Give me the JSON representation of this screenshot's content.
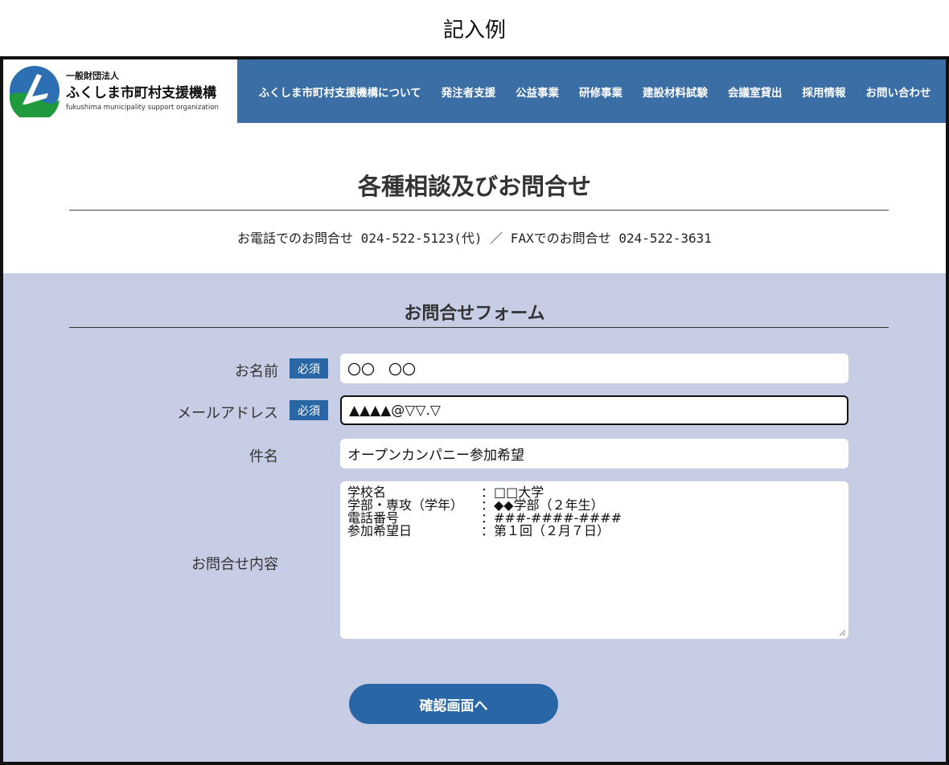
{
  "caption": "記入例",
  "logo": {
    "small_text": "一般財団法人",
    "main_text": "ふくしま市町村支援機構",
    "english_text": "fukushima municipality support organization"
  },
  "nav": {
    "items": [
      {
        "label": "ふくしま市町村支援機構について"
      },
      {
        "label": "発注者支援"
      },
      {
        "label": "公益事業"
      },
      {
        "label": "研修事業"
      },
      {
        "label": "建設材料試験"
      },
      {
        "label": "会議室貸出"
      },
      {
        "label": "採用情報"
      },
      {
        "label": "お問い合わせ"
      }
    ]
  },
  "contact": {
    "title": "各種相談及びお問合せ",
    "phone_line": "お電話でのお問合せ 024-522-5123(代) ／ FAXでのお問合せ 024-522-3631"
  },
  "form": {
    "title": "お問合せフォーム",
    "required_label": "必須",
    "name": {
      "label": "お名前",
      "value": "〇〇　〇〇"
    },
    "email": {
      "label": "メールアドレス",
      "value": "▲▲▲▲@▽▽.▽"
    },
    "subject": {
      "label": "件名",
      "value": "オープンカンパニー参加希望"
    },
    "message": {
      "label": "お問合せ内容",
      "lines": [
        {
          "key": "学校名",
          "value": "：□□大学"
        },
        {
          "key": "学部・専攻（学年）",
          "value": "：◆◆学部（２年生）"
        },
        {
          "key": "電話番号",
          "value": "：###-####-####"
        },
        {
          "key": "参加希望日",
          "value": "：第１回（２月７日）"
        }
      ]
    },
    "submit_label": "確認画面へ"
  },
  "colors": {
    "nav_bg": "#3b6ea5",
    "form_bg": "#c8cde6",
    "accent": "#2866a5",
    "logo_blue": "#2d6fb3",
    "logo_green": "#1f9a3c"
  }
}
